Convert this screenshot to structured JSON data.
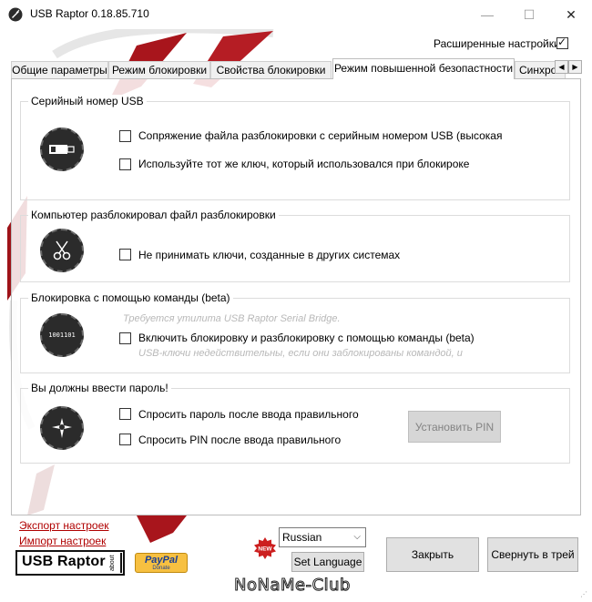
{
  "window": {
    "title": "USB Raptor 0.18.85.710",
    "minimize_glyph": "—",
    "maximize_glyph": "☐",
    "close_glyph": "✕"
  },
  "advanced": {
    "label": "Расширенные настройки",
    "checked": true
  },
  "tabs": [
    {
      "label": "Общие параметры"
    },
    {
      "label": "Режим блокировки"
    },
    {
      "label": "Свойства блокировки"
    },
    {
      "label": "Режим повышенной безопастности",
      "active": true
    },
    {
      "label": "Синхро"
    }
  ],
  "tab_scroll": {
    "left": "◀",
    "right": "▶"
  },
  "groups": {
    "serial": {
      "title": "Серийный номер USB",
      "options": [
        "Сопряжение файла разблокировки с серийным номером USB (высокая",
        "Используйте тот же ключ, который использовался при блокироке"
      ]
    },
    "computer": {
      "title": "Компьютер разблокировал файл разблокировки",
      "options": [
        "Не принимать ключи, созданные в других системах"
      ]
    },
    "command": {
      "title": "Блокировка с помощью команды (beta)",
      "hint_top": "Требуется утилита USB Raptor Serial Bridge.",
      "options": [
        "Включить блокировку и разблокировку с помощью команды (beta)"
      ],
      "hint_bottom": "USB-ключи недействительны, если они заблокированы командой, и",
      "icon_text": "1001101"
    },
    "password": {
      "title": "Вы должны ввести пароль!",
      "options": [
        "Спросить пароль после ввода правильного",
        "Спросить PIN после ввода правильного"
      ],
      "pin_button": "Установить PIN"
    }
  },
  "footer": {
    "export_link": "Экспорт настроек",
    "import_link": "Импорт настроек",
    "logo_text": "USB Raptor",
    "logo_about": "about",
    "paypal_text": "PayPal",
    "paypal_sub": "Donate",
    "new_badge": "NEW",
    "language_selected": "Russian",
    "set_language_button": "Set Language",
    "close_button": "Закрыть",
    "minimize_tray_button": "Свернуть в трей",
    "watermark": "NoNaMe-Club"
  },
  "colors": {
    "accent_red": "#b00000",
    "icon_dark": "#2b2b2b",
    "paypal_yellow": "#f7c041",
    "paypal_blue": "#1c3f94"
  }
}
